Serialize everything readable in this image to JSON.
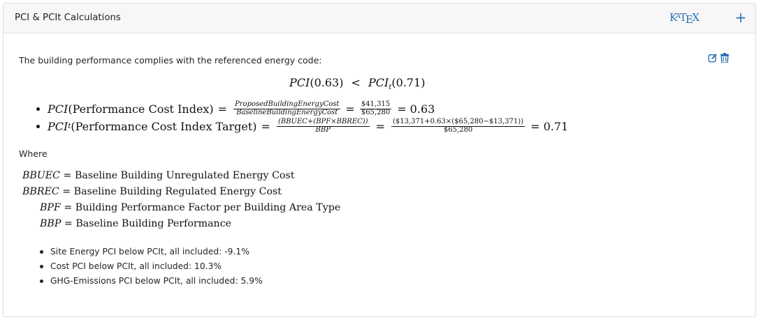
{
  "panel": {
    "title": "PCI & PCIt Calculations",
    "katex_badge": {
      "k": "K",
      "a": "A",
      "t": "T",
      "e": "E",
      "x": "X"
    },
    "add_button": "+",
    "intro": "The building performance complies with the referenced energy code:"
  },
  "equation": {
    "pci": "PCI",
    "pci_value": "(0.63)",
    "less_than": "<",
    "pcit": "PCI",
    "pcit_sub": "t",
    "pcit_value": "(0.71)"
  },
  "bullets": {
    "pci": {
      "label": "PCI",
      "desc": "(Performance Cost Index)",
      "eq1": "=",
      "num": "ProposedBuildingEnergyCost",
      "den": "BaselineBuildingEnergyCost",
      "eq2": "=",
      "num2": "$41,315",
      "den2": "$65,280",
      "result": "= 0.63"
    },
    "pcit": {
      "label": "PCI",
      "sub": "t",
      "desc": "(Performance Cost Index Target)",
      "eq1": "=",
      "num": "(BBUEC+(BPF×BBREC))",
      "den": "BBP",
      "eq2": "=",
      "num2": "($13,371+0.63×($65,280−$13,371))",
      "den2": "$65,280",
      "result": "= 0.71"
    }
  },
  "where_label": "Where",
  "definitions": [
    {
      "abbr": "BBUEC",
      "text": "= Baseline Building Unregulated Energy Cost"
    },
    {
      "abbr": "BBREC",
      "text": "= Baseline Building Regulated Energy Cost"
    },
    {
      "abbr": "BPF",
      "text": "= Building Performance Factor per Building Area Type"
    },
    {
      "abbr": "BBP",
      "text": "= Baseline Building Performance"
    }
  ],
  "results": [
    "Site Energy PCI below PCIt, all included: -9.1%",
    "Cost PCI below PCIt, all included: 10.3%",
    "GHG-Emissions PCI below PCIt, all included: 5.9%"
  ],
  "colors": {
    "accent": "#2a6fb3",
    "header_bg": "#f7f7f7",
    "border": "#d9dce0"
  },
  "icons": {
    "edit": "edit-icon",
    "delete": "trash-icon"
  }
}
